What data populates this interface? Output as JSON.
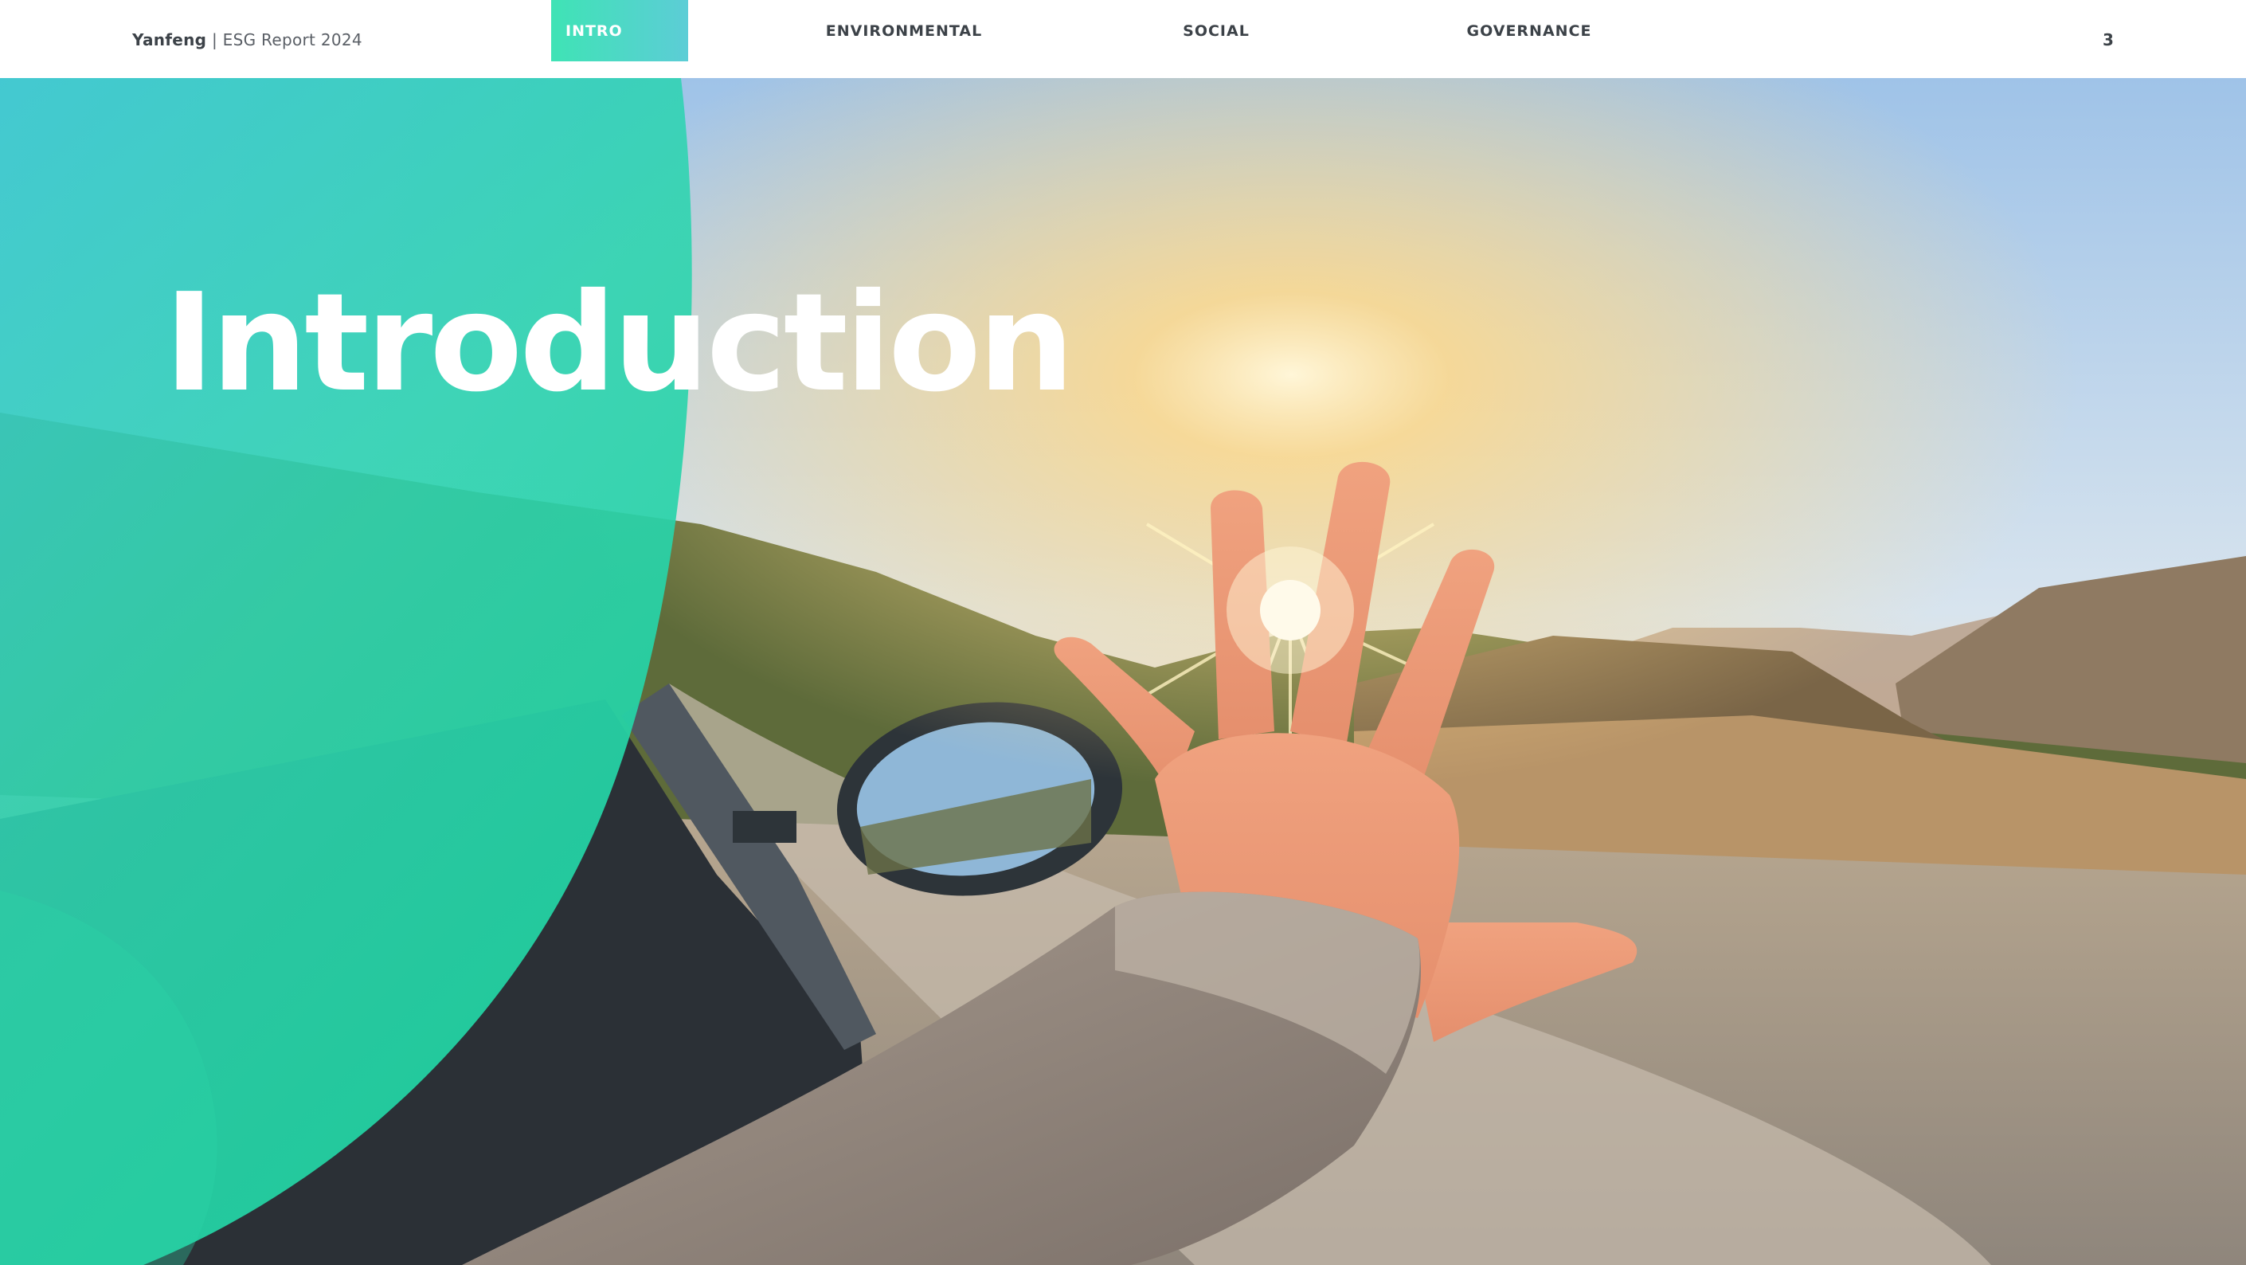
{
  "header": {
    "company": "Yanfeng",
    "separator": " | ",
    "report": "ESG Report 2024",
    "page_number": "3"
  },
  "nav": {
    "tabs": [
      {
        "label": "INTRO",
        "active": true
      },
      {
        "label": "ENVIRONMENTAL",
        "active": false
      },
      {
        "label": "SOCIAL",
        "active": false
      },
      {
        "label": "GOVERNANCE",
        "active": false
      }
    ]
  },
  "hero": {
    "title": "Introduction",
    "image_subject": "hand reaching toward sun from car window"
  },
  "colors": {
    "accent_start": "#3fe3b5",
    "accent_end": "#4ec9d6",
    "overlay_teal": "#22d4a6",
    "text_dark": "#3c4248"
  }
}
